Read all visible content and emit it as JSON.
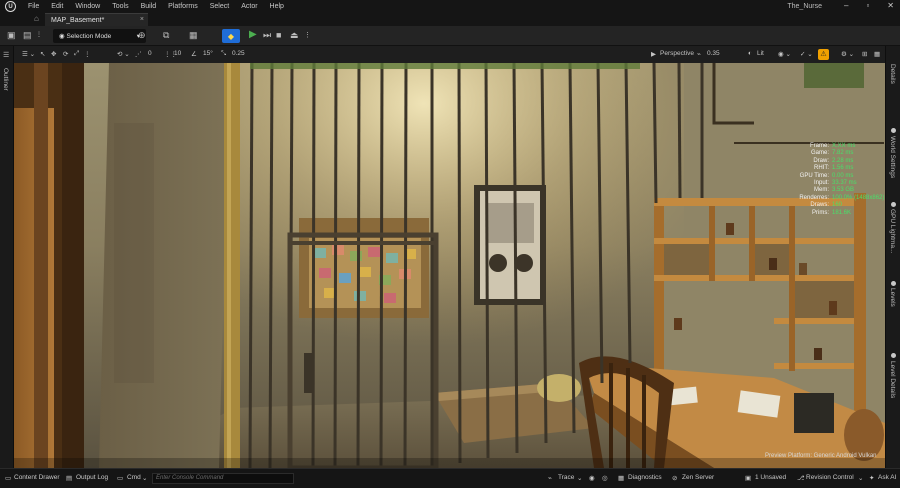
{
  "menubar": {
    "items": [
      "File",
      "Edit",
      "Window",
      "Tools",
      "Build",
      "Platforms",
      "Select",
      "Actor",
      "Help"
    ],
    "project_name": "The_Nurse",
    "window_controls": [
      "minimize",
      "maximize",
      "close"
    ]
  },
  "tabs": {
    "active_tab": "MAP_Basement*",
    "close_glyph": "×"
  },
  "toolbar": {
    "selection_mode": "Selection Mode"
  },
  "left_panel": {
    "outliner_label": "Outliner"
  },
  "right_panel": {
    "items": [
      "Details",
      "World Settings",
      "GPU Lightma...",
      "Levels",
      "Level Details"
    ]
  },
  "viewport_toolbar": {
    "snap_rotation_value": "0",
    "grid_size": "10",
    "rotation_snap": "15°",
    "scale_snap": "0.25",
    "view_mode": "Perspective",
    "camera_speed": "0.35",
    "lighting_mode": "Lit"
  },
  "stats": [
    {
      "label": "Frame:",
      "value": "X.XX ms"
    },
    {
      "label": "Game:",
      "value": "7.82 ms"
    },
    {
      "label": "Draw:",
      "value": "2.28 ms"
    },
    {
      "label": "RHIT:",
      "value": "1.56 ms"
    },
    {
      "label": "GPU Time:",
      "value": "0.00 ms"
    },
    {
      "label": "Input:",
      "value": "33.37 ms"
    },
    {
      "label": "Mem:",
      "value": "3.53 GB"
    },
    {
      "label": "Renderres:",
      "value": "100.0% (1488x862)"
    },
    {
      "label": "Draws:",
      "value": "160"
    },
    {
      "label": "Prims:",
      "value": "181.6K"
    }
  ],
  "preview": {
    "text": "Preview Platform:  Generic Android Vulkan"
  },
  "statusbar": {
    "content_drawer": "Content Drawer",
    "output_log": "Output Log",
    "cmd": "Cmd",
    "console_placeholder": "Enter Console Command",
    "trace": "Trace",
    "diagnostics": "Diagnostics",
    "zen_server": "Zen Server",
    "unsaved": "1 Unsaved",
    "revision_control": "Revision Control",
    "ask_ai": "Ask AI"
  },
  "colors": {
    "accent_blue": "#1f6dd8",
    "play_green": "#4caf50",
    "stat_green": "#48e06a",
    "warning_yellow": "#f0a000"
  }
}
